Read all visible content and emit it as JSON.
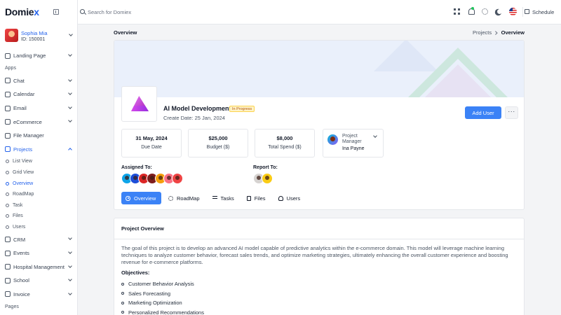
{
  "brand": {
    "logo_main": "Domie",
    "logo_x": "x"
  },
  "user": {
    "name": "Sophia Mia",
    "id": "ID: 150001"
  },
  "sidebar": {
    "landing": "Landing Page",
    "apps_label": "Apps",
    "chat": "Chat",
    "calendar": "Calendar",
    "email": "Email",
    "ecommerce": "eCommerce",
    "file_manager": "File Manager",
    "projects": "Projects",
    "project_sub": [
      "List View",
      "Grid View",
      "Overview",
      "RoadMap",
      "Task",
      "Files",
      "Users"
    ],
    "crm": "CRM",
    "events": "Events",
    "hospital": "Hospital Management",
    "school": "School",
    "invoice": "Invoice",
    "pages_label": "Pages"
  },
  "topbar": {
    "search_placeholder": "Search for Domiex",
    "schedule": "Schedule"
  },
  "page": {
    "title": "Overview",
    "breadcrumb_parent": "Projects",
    "breadcrumb_current": "Overview"
  },
  "project": {
    "title": "AI Model Development",
    "status": "In Progress",
    "create_date": "Create Date: 25 Jan, 2024",
    "add_user": "Add User",
    "more": "···",
    "due_date": {
      "value": "31 May, 2024",
      "label": "Due Date"
    },
    "budget": {
      "value": "$25,000",
      "label": "Budget ($)"
    },
    "total_spend": {
      "value": "$8,000",
      "label": "Total Spend ($)"
    },
    "manager": {
      "role": "Project Manager",
      "name": "Ina Payne"
    },
    "assigned_label": "Assigned To:",
    "report_label": "Report To:"
  },
  "tabs": [
    "Overview",
    "RoadMap",
    "Tasks",
    "Files",
    "Users"
  ],
  "overview": {
    "title": "Project Overview",
    "description": "The goal of this project is to develop an advanced AI model capable of predictive analytics within the e-commerce domain. This model will leverage machine learning techniques to analyze customer behavior, forecast sales trends, and optimize marketing strategies, ultimately enhancing the overall customer experience and boosting revenue for e-commerce platforms.",
    "objectives_label": "Objectives:",
    "objectives": [
      "Customer Behavior Analysis",
      "Sales Forecasting",
      "Marketing Optimization",
      "Personalized Recommendations"
    ]
  },
  "colors": {
    "accent": "#3b82f6",
    "status_bg": "#fef3c7",
    "status_text": "#b45309"
  },
  "icons": [
    "search-icon",
    "grid-icon",
    "bell-icon",
    "gear-icon",
    "moon-icon",
    "flag-icon",
    "calendar-icon",
    "eye-icon",
    "roadmap-icon",
    "tasks-icon",
    "files-icon",
    "users-icon"
  ]
}
